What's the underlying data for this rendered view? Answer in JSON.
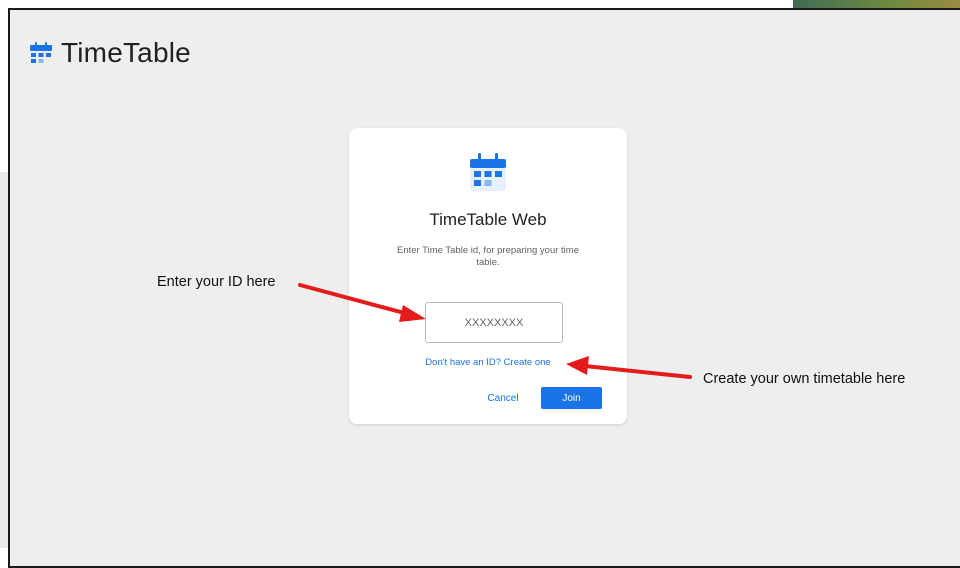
{
  "app": {
    "brand_title": "TimeTable",
    "logo_icon": "calendar-icon",
    "accent_color": "#1a73e8"
  },
  "dialog": {
    "icon": "calendar-icon",
    "title": "TimeTable Web",
    "subtitle": "Enter Time Table id, for preparing your time table.",
    "input_placeholder": "XXXXXXXX",
    "create_link": "Don't have an ID? Create one",
    "cancel_label": "Cancel",
    "join_label": "Join"
  },
  "annotations": {
    "enter_id": "Enter your ID here",
    "create_timetable": "Create your own timetable here",
    "arrow_color": "#e31b1b"
  }
}
